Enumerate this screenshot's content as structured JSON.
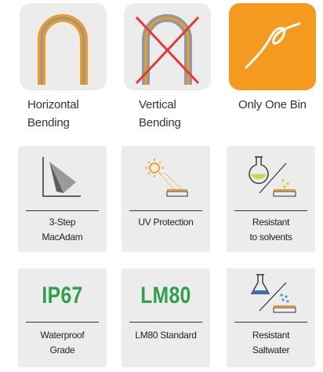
{
  "features": {
    "horizontal_bending": {
      "label": "Horizontal\nBending",
      "icon": "arch-bend-icon"
    },
    "vertical_bending": {
      "label": "Vertical\nBending",
      "icon": "crossed-arch-icon"
    },
    "only_one_bin": {
      "label": "Only One Bin",
      "icon": "light-curve-icon"
    },
    "macadam": {
      "label": "3-Step\nMacAdam",
      "icon": "macadam-ellipse-icon"
    },
    "uv": {
      "label": "UV Protection",
      "icon": "sun-uv-icon"
    },
    "solvents": {
      "label": "Resistant\nto solvents",
      "icon": "flask-solvent-icon"
    },
    "ip67": {
      "label": "Waterproof\nGrade",
      "badge": "IP67"
    },
    "lm80": {
      "label": "LM80 Standard",
      "badge": "LM80"
    },
    "saltwater": {
      "label": "Resistant\nSaltwater",
      "icon": "flask-saltwater-icon"
    }
  },
  "colors": {
    "orange": "#f39a1f",
    "green": "#2ea04a",
    "tile_grey": "#ececec",
    "red_cross": "#e53935"
  }
}
